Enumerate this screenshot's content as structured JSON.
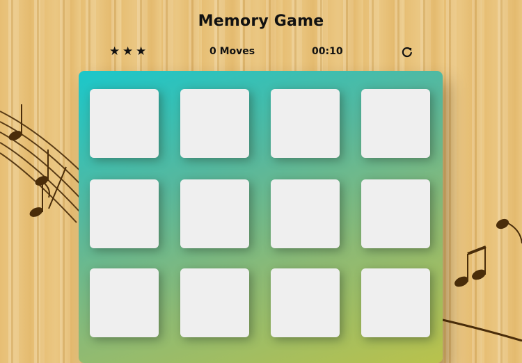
{
  "game": {
    "title": "Memory Game",
    "moves_label": "0 Moves",
    "timer": "00:10",
    "stars": [
      "★",
      "★",
      "★"
    ],
    "restart_icon": "restart-icon"
  },
  "deck": {
    "card_count_visible": 12,
    "cards": [
      {
        "state": "face-down"
      },
      {
        "state": "face-down"
      },
      {
        "state": "face-down"
      },
      {
        "state": "face-down"
      },
      {
        "state": "face-down"
      },
      {
        "state": "face-down"
      },
      {
        "state": "face-down"
      },
      {
        "state": "face-down"
      },
      {
        "state": "face-down"
      },
      {
        "state": "face-down"
      },
      {
        "state": "face-down"
      },
      {
        "state": "face-down"
      }
    ]
  },
  "colors": {
    "deck_gradient_start": "#1bc7ca",
    "deck_gradient_end": "#b9c24c",
    "card_face": "#efefef",
    "text": "#111111"
  }
}
